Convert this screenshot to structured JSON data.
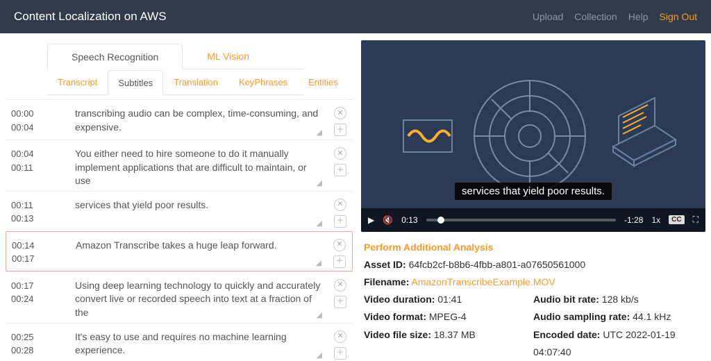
{
  "header": {
    "title": "Content Localization on AWS",
    "nav": {
      "upload": "Upload",
      "collection": "Collection",
      "help": "Help",
      "signout": "Sign Out"
    }
  },
  "tabs_top": {
    "speech": "Speech Recognition",
    "vision": "ML Vision"
  },
  "tabs_sub": {
    "transcript": "Transcript",
    "subtitles": "Subtitles",
    "translation": "Translation",
    "keyphrases": "KeyPhrases",
    "entities": "Entities"
  },
  "rows": [
    {
      "start": "00:00",
      "end": "00:04",
      "text": "transcribing audio can be complex, time-consuming, and expensive."
    },
    {
      "start": "00:04",
      "end": "00:11",
      "text": "You either need to hire someone to do it manually implement applications that are difficult to maintain, or use"
    },
    {
      "start": "00:11",
      "end": "00:13",
      "text": "services that yield poor results."
    },
    {
      "start": "00:14",
      "end": "00:17",
      "text": "Amazon Transcribe takes a huge leap forward.",
      "selected": true
    },
    {
      "start": "00:17",
      "end": "00:24",
      "text": "Using deep learning technology to quickly and accurately convert live or recorded speech into text at a fraction of the"
    },
    {
      "start": "00:25",
      "end": "00:28",
      "text": "It's easy to use and requires no machine learning experience."
    }
  ],
  "video": {
    "caption": "services that yield poor results.",
    "elapsed": "0:13",
    "remaining": "-1:28",
    "speed": "1x"
  },
  "analysis": {
    "link": "Perform Additional Analysis",
    "asset_id_label": "Asset ID:",
    "asset_id": "64fcb2cf-b8b6-4fbb-a801-a07650561000",
    "filename_label": "Filename:",
    "filename": "AmazonTranscribeExample.MOV",
    "duration_label": "Video duration:",
    "duration": "01:41",
    "format_label": "Video format:",
    "format": "MPEG-4",
    "size_label": "Video file size:",
    "size": "18.37 MB",
    "abitrate_label": "Audio bit rate:",
    "abitrate": "128 kb/s",
    "asample_label": "Audio sampling rate:",
    "asample": "44.1 kHz",
    "encoded_label": "Encoded date:",
    "encoded": "UTC 2022-01-19 04:07:40"
  }
}
